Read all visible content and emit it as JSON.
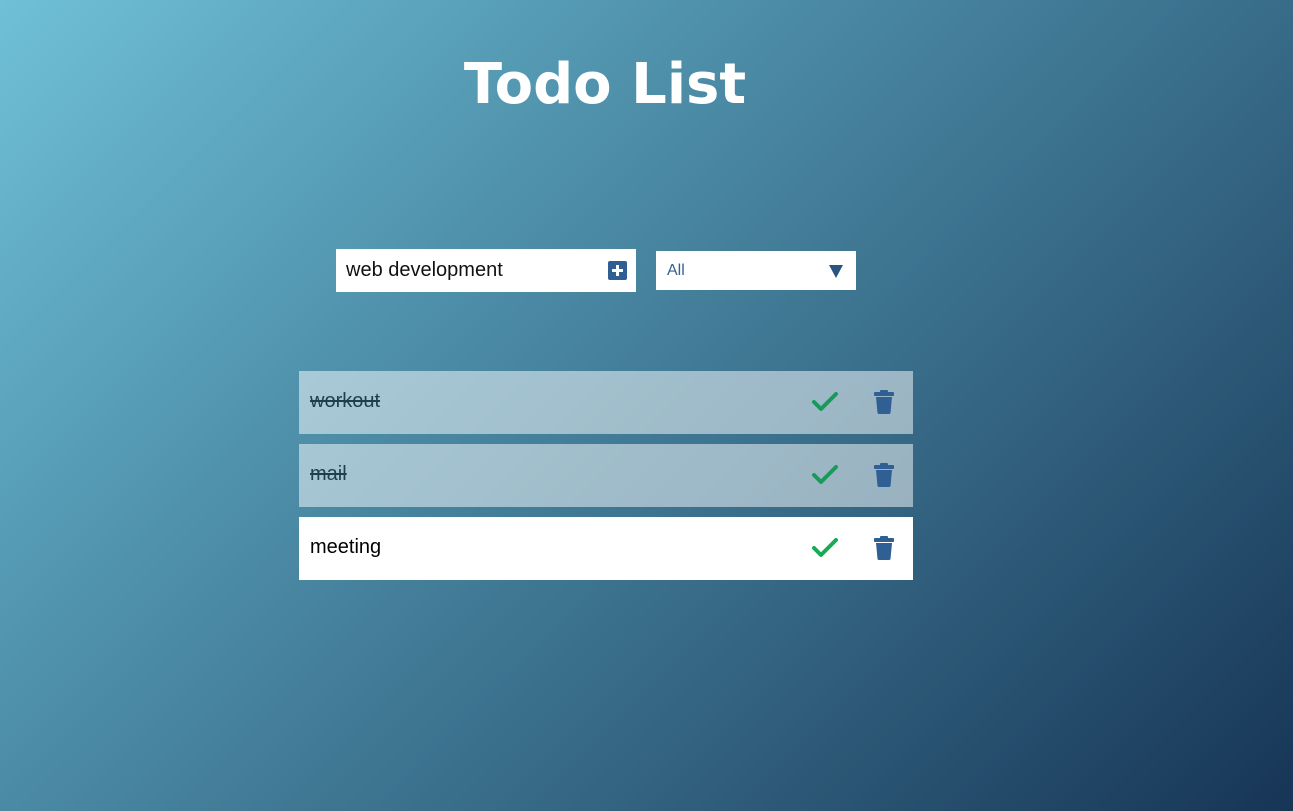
{
  "app": {
    "title": "Todo List"
  },
  "form": {
    "input_value": "web development",
    "filter": {
      "selected": "All",
      "options": [
        "All"
      ]
    }
  },
  "todos": [
    {
      "text": "workout",
      "completed": true
    },
    {
      "text": "mail",
      "completed": true
    },
    {
      "text": "meeting",
      "completed": false
    }
  ],
  "colors": {
    "accent": "#2f5f93",
    "check": "#1a9a5a",
    "trash": "#2f5f93",
    "gradient_start": "#6fc0d8",
    "gradient_end": "#173556"
  },
  "icons": {
    "add": "plus-square-icon",
    "filter": "chevron-down-icon",
    "complete": "check-icon",
    "delete": "trash-icon"
  }
}
